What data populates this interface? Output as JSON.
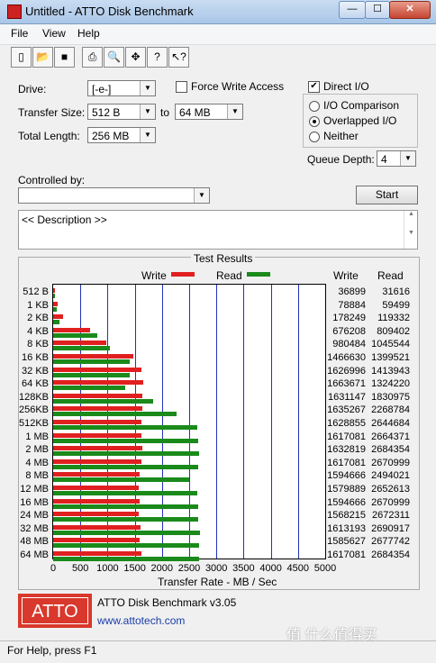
{
  "window": {
    "title": "Untitled - ATTO Disk Benchmark",
    "min": "—",
    "max": "☐",
    "close": "✕"
  },
  "menu": [
    "File",
    "View",
    "Help"
  ],
  "toolbar_icons": [
    "new-file-icon",
    "open-folder-icon",
    "save-icon",
    "print-icon",
    "print-preview-icon",
    "move-icon",
    "help-icon",
    "context-help-icon"
  ],
  "form": {
    "drive_label": "Drive:",
    "drive_value": "[-e-]",
    "force_write_label": "Force Write Access",
    "force_write_checked": false,
    "direct_io_label": "Direct I/O",
    "direct_io_checked": true,
    "transfer_size_label": "Transfer Size:",
    "transfer_from": "512 B",
    "to_label": "to",
    "transfer_to": "64 MB",
    "total_length_label": "Total Length:",
    "total_length": "256 MB",
    "io_comparison": "I/O Comparison",
    "overlapped_io": "Overlapped I/O",
    "neither": "Neither",
    "queue_depth_label": "Queue Depth:",
    "queue_depth": "4",
    "controlled_by_label": "Controlled by:",
    "controlled_by": "",
    "start_label": "Start",
    "description": "<< Description >>"
  },
  "chart_data": {
    "type": "bar",
    "title": "Test Results",
    "xlabel": "Transfer Rate - MB / Sec",
    "xlim": [
      0,
      5000
    ],
    "xticks": [
      "0",
      "500",
      "1000",
      "1500",
      "2000",
      "2500",
      "3000",
      "3500",
      "4000",
      "4500",
      "5000"
    ],
    "write_color": "#e02020",
    "read_color": "#1a8a1a",
    "categories": [
      "512 B",
      "1 KB",
      "2 KB",
      "4 KB",
      "8 KB",
      "16 KB",
      "32 KB",
      "64 KB",
      "128KB",
      "256KB",
      "512KB",
      "1 MB",
      "2 MB",
      "4 MB",
      "8 MB",
      "12 MB",
      "16 MB",
      "24 MB",
      "32 MB",
      "48 MB",
      "64 MB"
    ],
    "series": [
      {
        "name": "Write",
        "values": [
          36.899,
          78.884,
          178.249,
          676.208,
          980.484,
          1466.63,
          1626.996,
          1663.671,
          1631.147,
          1635.267,
          1628.855,
          1617.081,
          1632.819,
          1617.081,
          1594.666,
          1579.889,
          1594.666,
          1568.215,
          1613.193,
          1585.627,
          1617.081
        ]
      },
      {
        "name": "Read",
        "values": [
          31.616,
          59.499,
          119.332,
          809.402,
          1045.544,
          1399.521,
          1413.943,
          1324.22,
          1830.975,
          2268.784,
          2644.684,
          2664.371,
          2684.354,
          2670.999,
          2494.021,
          2652.613,
          2670.999,
          2672.311,
          2690.917,
          2677.742,
          2684.354
        ]
      }
    ],
    "write_header": "Write",
    "read_header": "Read",
    "write_numbers": [
      "36899",
      "78884",
      "178249",
      "676208",
      "980484",
      "1466630",
      "1626996",
      "1663671",
      "1631147",
      "1635267",
      "1628855",
      "1617081",
      "1632819",
      "1617081",
      "1594666",
      "1579889",
      "1594666",
      "1568215",
      "1613193",
      "1585627",
      "1617081"
    ],
    "read_numbers": [
      "31616",
      "59499",
      "119332",
      "809402",
      "1045544",
      "1399521",
      "1413943",
      "1324220",
      "1830975",
      "2268784",
      "2644684",
      "2664371",
      "2684354",
      "2670999",
      "2494021",
      "2652613",
      "2670999",
      "2672311",
      "2690917",
      "2677742",
      "2684354"
    ]
  },
  "footer": {
    "logo": "ATTO",
    "product": "ATTO Disk Benchmark v3.05",
    "url": "www.attotech.com",
    "watermark": "值 什么值得买"
  },
  "status": "For Help, press F1"
}
